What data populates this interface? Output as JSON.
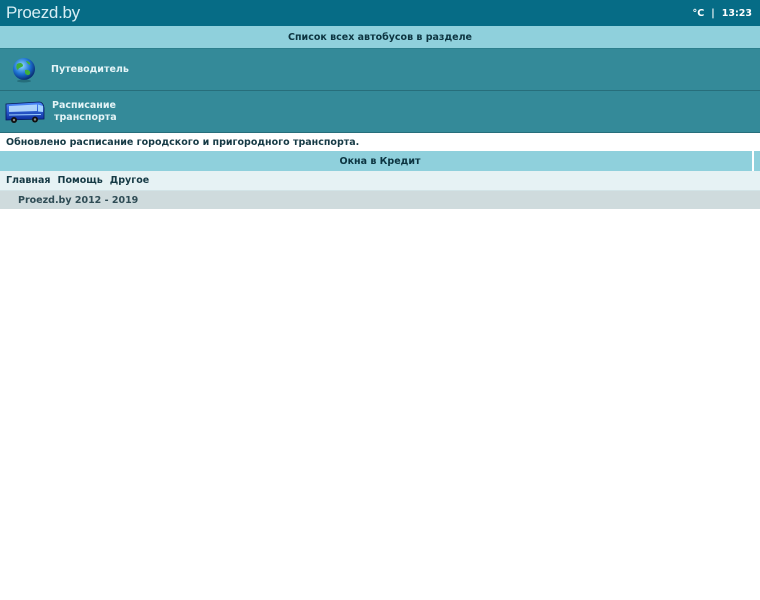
{
  "header": {
    "logo_text": "Proezd.by",
    "temperature_unit": "°C",
    "separator": "|",
    "time": "13:23"
  },
  "section_title": "Список всех автобусов в разделе",
  "nav": {
    "guide": {
      "label": "Путеводитель",
      "icon": "globe-icon"
    },
    "schedule": {
      "label_line1": "Расписание",
      "label_line2": "транспорта",
      "icon": "bus-icon"
    }
  },
  "notice": "Обновлено расписание городского и пригородного транспорта.",
  "credit_bar": "Окна в Кредит",
  "menu": {
    "items": [
      "Главная",
      "Помощь",
      "Другое"
    ]
  },
  "footer": "Proezd.by 2012 - 2019",
  "colors": {
    "topbar": "#066c86",
    "section_bar": "#8fd0dc",
    "nav_row": "#348a99",
    "menu_bg": "#e6f2f4",
    "footer_bg": "#cfdbdd"
  }
}
